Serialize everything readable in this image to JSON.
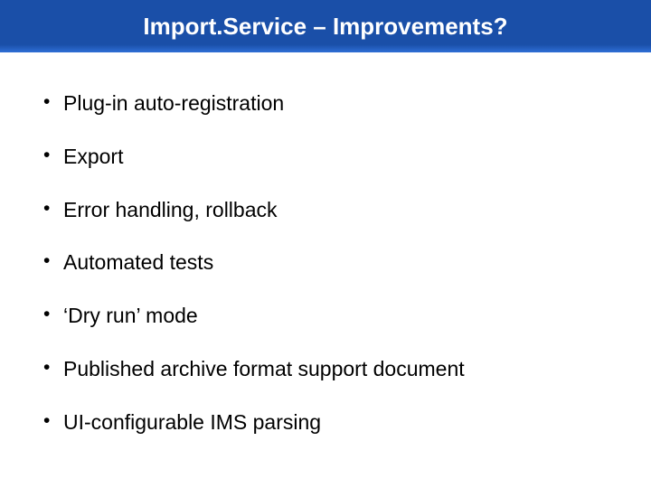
{
  "slide": {
    "title": "Import.Service – Improvements?",
    "bullets": [
      "Plug-in auto-registration",
      "Export",
      "Error handling, rollback",
      "Automated tests",
      "‘Dry run’ mode",
      "Published archive format support document",
      "UI-configurable IMS parsing"
    ]
  }
}
